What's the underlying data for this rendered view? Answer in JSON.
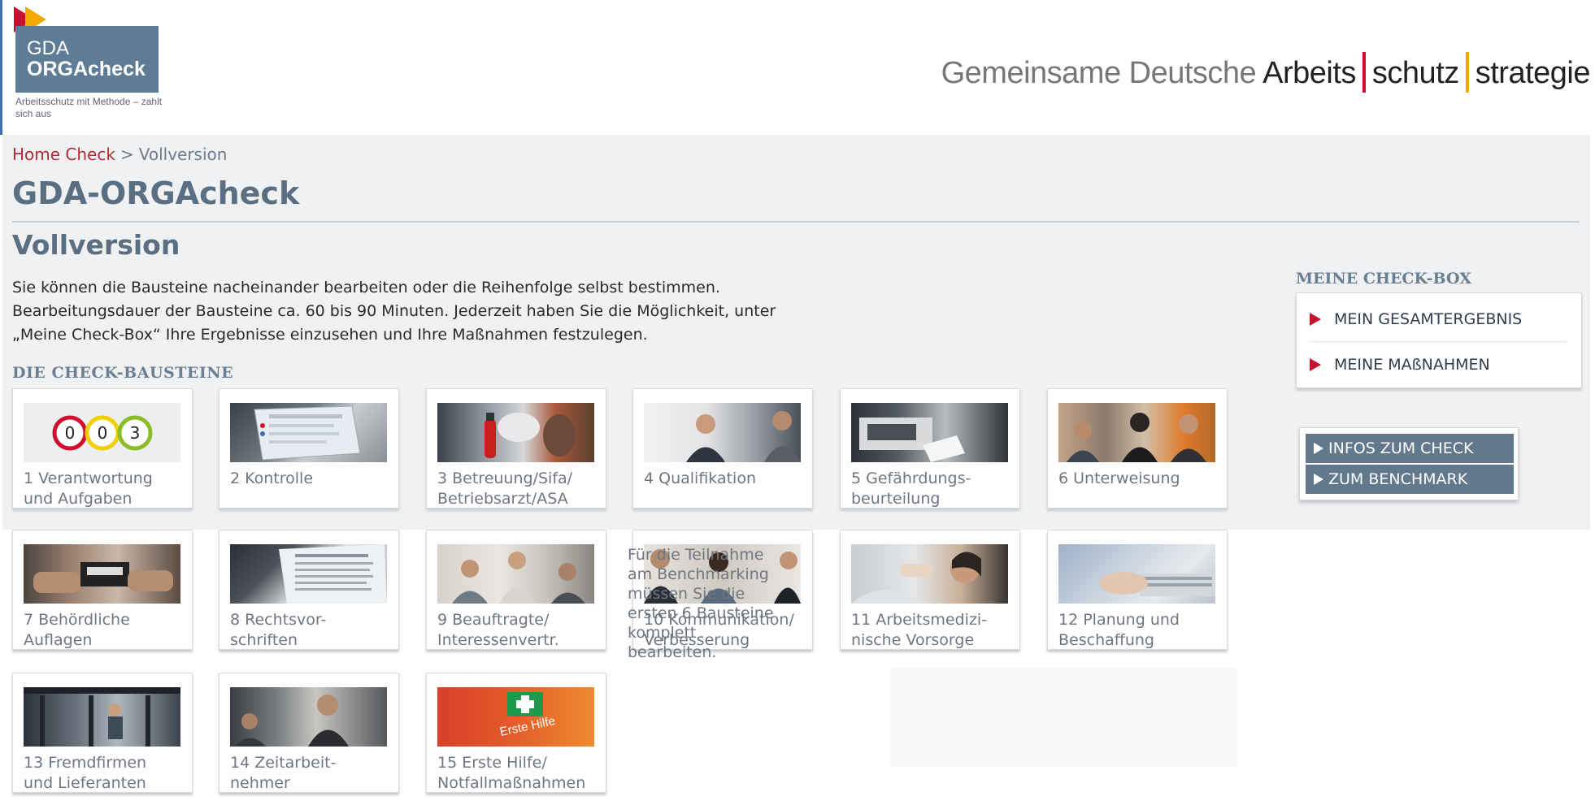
{
  "header": {
    "logo": {
      "line1": "GDA",
      "line2": "ORGAcheck",
      "tagline": "Arbeitsschutz mit Methode – zahlt sich aus"
    },
    "gda_title": {
      "part1": "Gemeinsame Deutsche",
      "part2": "Arbeits",
      "part3": "schutz",
      "part4": "strategie"
    }
  },
  "breadcrumb": {
    "home": "Home Check",
    "separator": ">",
    "current": "Vollversion"
  },
  "page_title": "GDA-ORGAcheck",
  "sub_title": "Vollversion",
  "intro": {
    "line1": "Sie können die Bausteine nacheinander bearbeiten oder die Reihenfolge selbst bestimmen.",
    "line2": "Bearbeitungsdauer der Bausteine ca. 60 bis 90 Minuten. Jederzeit haben Sie die Möglichkeit, unter",
    "line3": "„Meine Check-Box“ Ihre Ergebnisse einzusehen und Ihre Maßnahmen festzulegen."
  },
  "section_heading": "DIE CHECK-BAUSTEINE",
  "tiles": [
    {
      "line1": "1 Verantwortung",
      "line2": "und Aufgaben"
    },
    {
      "line1": "2 Kontrolle",
      "line2": ""
    },
    {
      "line1": "3 Betreuung/Sifa/",
      "line2": "Betriebsarzt/ASA"
    },
    {
      "line1": "4 Qualifikation",
      "line2": ""
    },
    {
      "line1": "5 Gefährdungs-",
      "line2": "beurteilung"
    },
    {
      "line1": "6 Unterweisung",
      "line2": ""
    },
    {
      "line1": "7 Behördliche",
      "line2": "Auflagen"
    },
    {
      "line1": "8 Rechtsvor-",
      "line2": "schriften"
    },
    {
      "line1": "9 Beauftragte/",
      "line2": "Interessenvertr."
    },
    {
      "line1": "10 Kommunikation/",
      "line2": "Verbesserung"
    },
    {
      "line1": "11 Arbeitsmedizi-",
      "line2": "nische Vorsorge"
    },
    {
      "line1": "12 Planung und",
      "line2": "Beschaffung"
    },
    {
      "line1": "13 Fremdfirmen",
      "line2": "und Lieferanten"
    },
    {
      "line1": "14 Zeitarbeit-",
      "line2": "nehmer"
    },
    {
      "line1": "15 Erste Hilfe/",
      "line2": "Notfallmaßnahmen"
    }
  ],
  "tile1_circles": [
    "0",
    "0",
    "3"
  ],
  "tile15_sign": "Erste Hilfe",
  "benchmark_note": {
    "line1": "Für die Teilnahme",
    "line2": "am Benchmarking",
    "line3": "müssen Sie die",
    "line4": "ersten 6 Bausteine",
    "line5": "komplett",
    "line6": "bearbeiten."
  },
  "check_box": {
    "heading": "MEINE CHECK-BOX",
    "items": [
      "MEIN GESAMTERGEBNIS",
      "MEINE MAßNAHMEN"
    ]
  },
  "info_buttons": [
    "INFOS ZUM CHECK",
    "ZUM BENCHMARK"
  ],
  "colors": {
    "accent_red": "#c8102e",
    "accent_gold": "#f2a900",
    "slate": "#5b6f82",
    "button_bg": "#61788d"
  }
}
